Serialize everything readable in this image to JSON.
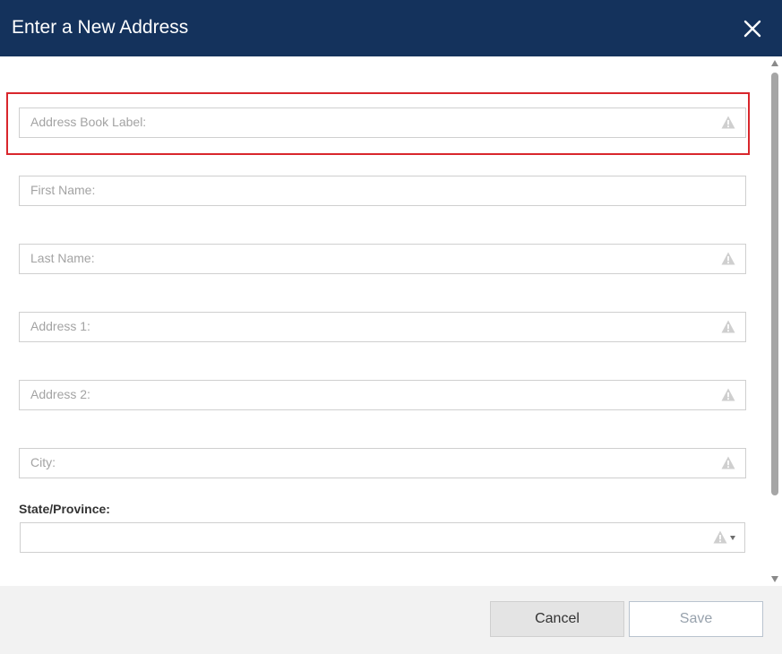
{
  "dialog": {
    "title": "Enter a New Address",
    "close_icon": "close-icon"
  },
  "form": {
    "fields": [
      {
        "label": "Address Book Label:",
        "value": "",
        "required": true
      },
      {
        "label": "First Name:",
        "value": "",
        "required": false
      },
      {
        "label": "Last Name:",
        "value": "",
        "required": true
      },
      {
        "label": "Address 1:",
        "value": "",
        "required": true
      },
      {
        "label": "Address 2:",
        "value": "",
        "required": true
      },
      {
        "label": "City:",
        "value": "",
        "required": true
      }
    ],
    "state": {
      "label": "State/Province:",
      "selected": "",
      "required": true
    }
  },
  "footer": {
    "cancel_label": "Cancel",
    "save_label": "Save"
  },
  "colors": {
    "header_bg": "#14325c",
    "focus_ring": "#d9262c",
    "warning_icon": "#cfcfcf"
  }
}
